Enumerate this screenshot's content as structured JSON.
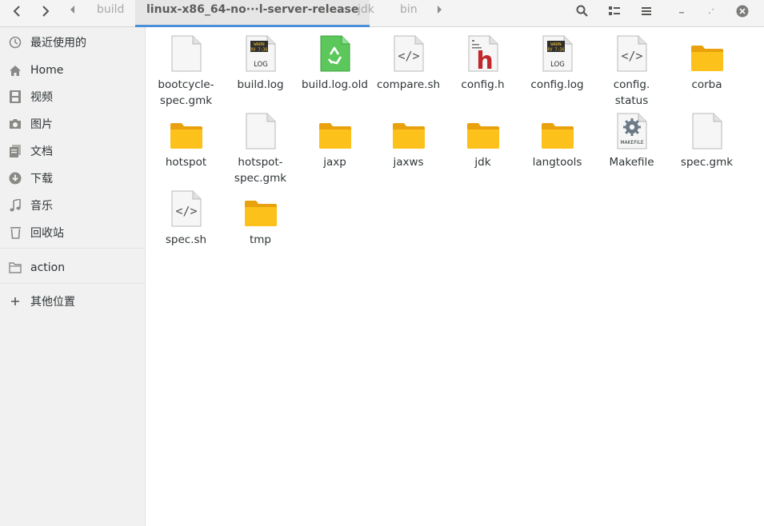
{
  "breadcrumbs": {
    "build": "build",
    "current": "linux-x86_64-no···l-server-release",
    "jdk": "jdk",
    "bin": "bin"
  },
  "sidebar": {
    "recent": "最近使用的",
    "home": "Home",
    "videos": "视频",
    "pictures": "图片",
    "documents": "文档",
    "downloads": "下载",
    "music": "音乐",
    "trash": "回收站",
    "action": "action",
    "other": "其他位置"
  },
  "files": [
    {
      "name": "bootcycle-\nspec.gmk",
      "icon": "text-file-icon"
    },
    {
      "name": "build.log",
      "icon": "log-file-icon"
    },
    {
      "name": "build.log.old",
      "icon": "recycle-file-icon"
    },
    {
      "name": "compare.sh",
      "icon": "script-file-icon"
    },
    {
      "name": "config.h",
      "icon": "header-file-icon"
    },
    {
      "name": "config.log",
      "icon": "log-file-icon"
    },
    {
      "name": "config.\nstatus",
      "icon": "script-file-icon"
    },
    {
      "name": "corba",
      "icon": "folder-icon"
    },
    {
      "name": "hotspot",
      "icon": "folder-icon"
    },
    {
      "name": "hotspot-\nspec.gmk",
      "icon": "text-file-icon"
    },
    {
      "name": "jaxp",
      "icon": "folder-icon"
    },
    {
      "name": "jaxws",
      "icon": "folder-icon"
    },
    {
      "name": "jdk",
      "icon": "folder-icon"
    },
    {
      "name": "langtools",
      "icon": "folder-icon"
    },
    {
      "name": "Makefile",
      "icon": "makefile-icon"
    },
    {
      "name": "spec.gmk",
      "icon": "text-file-icon"
    },
    {
      "name": "spec.sh",
      "icon": "script-file-icon"
    },
    {
      "name": "tmp",
      "icon": "folder-icon"
    }
  ],
  "icon_text": {
    "log_warn": "WARN",
    "log_time": "RV 7:36",
    "log_label": "LOG",
    "makefile_label": "MAKEFILE",
    "header_letter": "h"
  },
  "colors": {
    "folder": "#fcc21b",
    "accent": "#4a90d9"
  }
}
